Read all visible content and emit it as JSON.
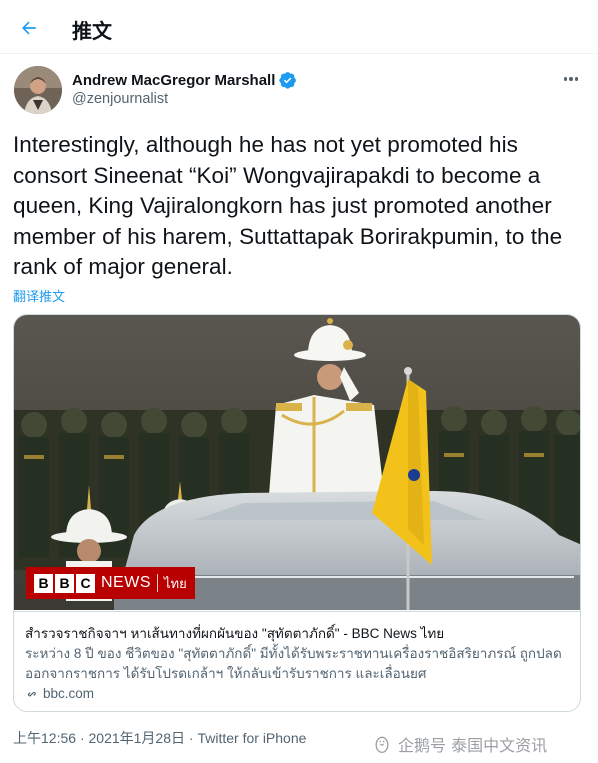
{
  "header": {
    "title": "推文",
    "back_icon": "arrow-left-icon"
  },
  "tweet": {
    "author_name": "Andrew MacGregor Marshall",
    "author_handle": "@zenjournalist",
    "verified": true,
    "text": "Interestingly, although he has not yet promoted his consort Sineenat “Koi” Wongvajirapakdi to become a queen, King Vajiralongkorn has just promoted another member of his harem, Suttattapak Borirakpumin, to the rank of major general.",
    "translate_label": "翻译推文"
  },
  "card": {
    "badge": {
      "logo_letters": [
        "B",
        "B",
        "C"
      ],
      "news": "NEWS",
      "lang": "ไทย"
    },
    "title": "สำรวจราชกิจจาฯ หาเส้นทางที่ผกผันของ \"สุทัตตาภักดิ์\" - BBC News ไทย",
    "description": "ระหว่าง 8 ปี ของ ชีวิตของ \"สุทัตตาภักดิ์\" มีทั้งได้รับพระราชทานเครื่องราชอิสริยาภรณ์ ถูกปลดออกจากราชการ ได้รับโปรดเกล้าฯ ให้กลับเข้ารับราชการ และเลื่อนยศ",
    "domain": "bbc.com"
  },
  "meta": {
    "time": "上午12:56",
    "sep": "·",
    "date": "2021年1月28日",
    "app": "Twitter for iPhone"
  },
  "watermark": {
    "text": "企鹅号 泰国中文资讯"
  },
  "colors": {
    "accent": "#1d9bf0",
    "bbc_red": "#b80000",
    "flag_yellow": "#f2c21b"
  }
}
